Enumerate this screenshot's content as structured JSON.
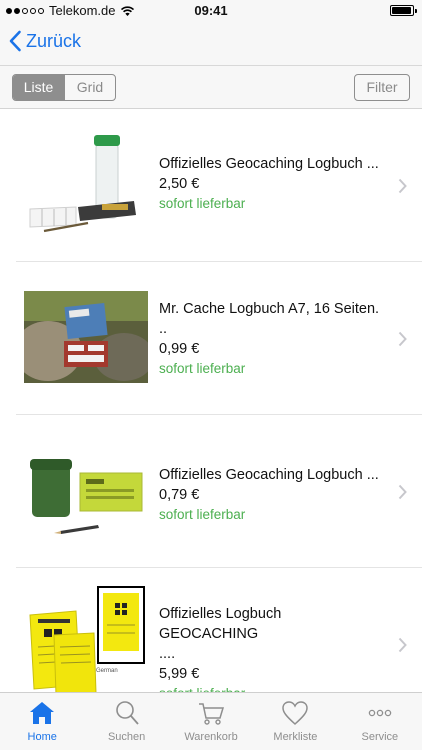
{
  "status_bar": {
    "carrier": "Telekom.de",
    "time": "09:41",
    "battery_level": 0.95
  },
  "nav": {
    "back_label": "Zurück"
  },
  "toolbar": {
    "view_list": "Liste",
    "view_grid": "Grid",
    "filter": "Filter"
  },
  "products": [
    {
      "title_line1": "Offizielles Geocaching Logbuch ...",
      "title_line2": "",
      "price": "2,50 €",
      "availability": "sofort lieferbar"
    },
    {
      "title_line1": "Mr. Cache Logbuch A7, 16 Seiten.",
      "title_line2": "..",
      "price": "0,99 €",
      "availability": "sofort lieferbar"
    },
    {
      "title_line1": "Offizielles Geocaching Logbuch ...",
      "title_line2": "",
      "price": "0,79 €",
      "availability": "sofort lieferbar"
    },
    {
      "title_line1": "Offizielles Logbuch GEOCACHING",
      "title_line2": "....",
      "price": "5,99 €",
      "availability": "sofort lieferbar",
      "image_caption": "German"
    }
  ],
  "tabs": [
    {
      "label": "Home",
      "icon": "home-icon",
      "active": true
    },
    {
      "label": "Suchen",
      "icon": "search-icon"
    },
    {
      "label": "Warenkorb",
      "icon": "cart-icon"
    },
    {
      "label": "Merkliste",
      "icon": "heart-icon"
    },
    {
      "label": "Service",
      "icon": "more-icon"
    }
  ],
  "colors": {
    "accent": "#1a73e8",
    "availability": "#4caf50",
    "bar": "#f7f7f7"
  }
}
